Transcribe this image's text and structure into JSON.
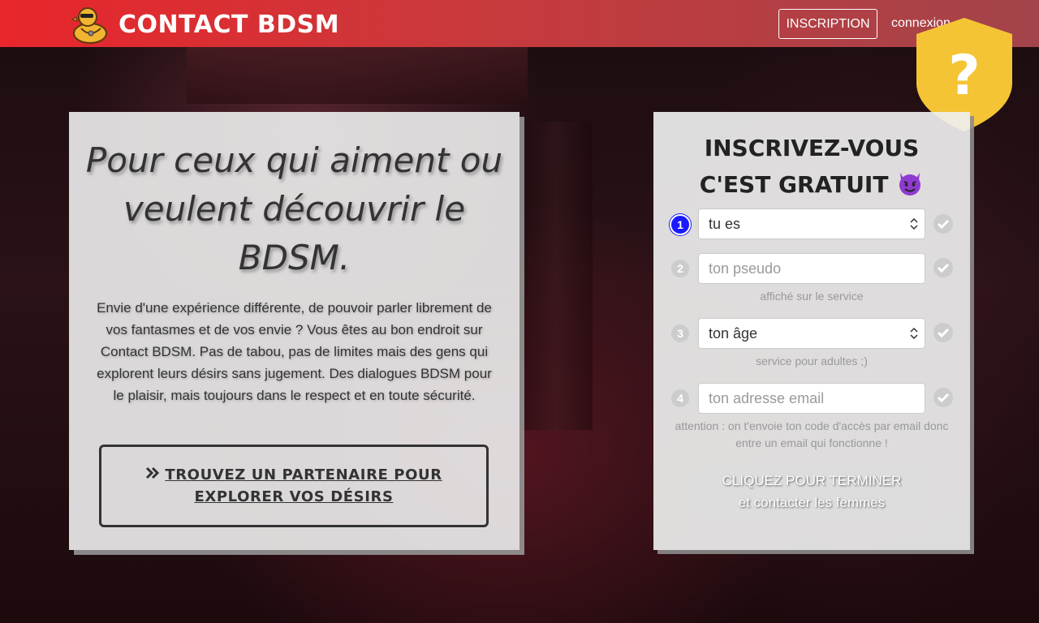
{
  "navbar": {
    "brand_name": "CONTACT BDSM",
    "inscription_label": "INSCRIPTION",
    "connexion_label": "connexion",
    "logo_icon": "rubber-duck-icon"
  },
  "shield": {
    "glyph": "?",
    "icon": "help-shield-icon",
    "color": "#f5c435"
  },
  "hero": {
    "title": "Pour ceux qui aiment ou veulent découvrir le BDSM.",
    "text": "Envie d'une expérience différente, de pouvoir parler librement de vos fantasmes et de vos envie ? Vous êtes au bon endroit sur Contact BDSM. Pas de tabou, pas de limites mais des gens qui explorent leurs désirs sans jugement. Des dialogues BDSM pour le plaisir, mais toujours dans le respect et en toute sécurité.",
    "cta_label": "TROUVEZ UN PARTENAIRE POUR EXPLORER VOS DÉSIRS",
    "cta_icon": "double-chevron-right-icon"
  },
  "signup": {
    "title_line1": "INSCRIVEZ-VOUS",
    "title_line2": "C'EST GRATUIT",
    "title_icon": "devil-emoji-icon",
    "steps": [
      {
        "number": "1",
        "value": "tu es",
        "kind": "select"
      },
      {
        "number": "2",
        "placeholder": "ton pseudo",
        "hint": "affiché sur le service",
        "kind": "input"
      },
      {
        "number": "3",
        "value": "ton âge",
        "hint": "service pour adultes ;)",
        "kind": "select"
      },
      {
        "number": "4",
        "placeholder": "ton adresse email",
        "hint": "attention : on t'envoie ton code d'accès par email donc entre un email qui fonctionne !",
        "kind": "input"
      }
    ],
    "submit_line1": "CLIQUEZ POUR TERMINER",
    "submit_line2": "et contacter les femmes"
  },
  "colors": {
    "navbar_start": "#e8262b",
    "navbar_end": "#a2444a",
    "active_step": "#1a1aff",
    "panel_bg": "#eeeeee"
  }
}
